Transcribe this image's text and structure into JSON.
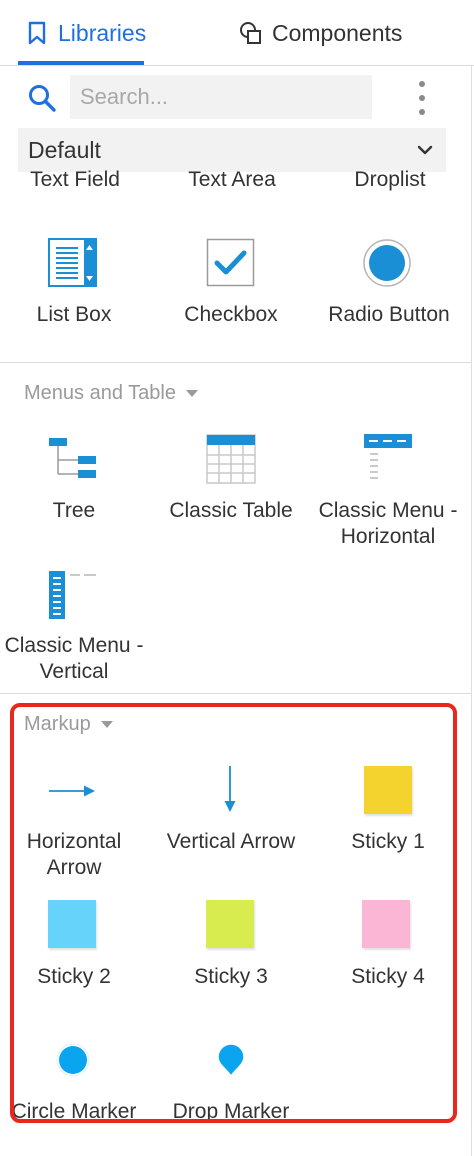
{
  "tabs": {
    "libraries": "Libraries",
    "components": "Components"
  },
  "search": {
    "placeholder": "Search..."
  },
  "library_select": {
    "value": "Default"
  },
  "forms": {
    "partial_items": [
      "Text Field",
      "Text Area",
      "Droplist"
    ],
    "items": [
      "List Box",
      "Checkbox",
      "Radio Button"
    ]
  },
  "menus_and_table": {
    "title": "Menus and Table",
    "items": [
      {
        "line1": "Tree",
        "line2": ""
      },
      {
        "line1": "Classic Table",
        "line2": ""
      },
      {
        "line1": "Classic Menu -",
        "line2": "Horizontal"
      },
      {
        "line1": "Classic Menu -",
        "line2": "Vertical"
      }
    ]
  },
  "markup": {
    "title": "Markup",
    "items": [
      {
        "line1": "Horizontal",
        "line2": "Arrow"
      },
      {
        "line1": "Vertical Arrow",
        "line2": ""
      },
      {
        "line1": "Sticky 1",
        "line2": ""
      },
      {
        "line1": "Sticky 2",
        "line2": ""
      },
      {
        "line1": "Sticky 3",
        "line2": ""
      },
      {
        "line1": "Sticky 4",
        "line2": ""
      },
      {
        "line1": "Circle Marker",
        "line2": ""
      },
      {
        "line1": "Drop Marker",
        "line2": ""
      }
    ]
  },
  "colors": {
    "accent": "#1f6fe0",
    "icon_blue": "#1a8fd6",
    "marker_blue": "#0aa4ef",
    "sticky_1": "#f4d32f",
    "sticky_2": "#66d3fa",
    "sticky_3": "#d8ec4f",
    "sticky_4": "#fbb6d5",
    "highlight": "#e8281e"
  }
}
